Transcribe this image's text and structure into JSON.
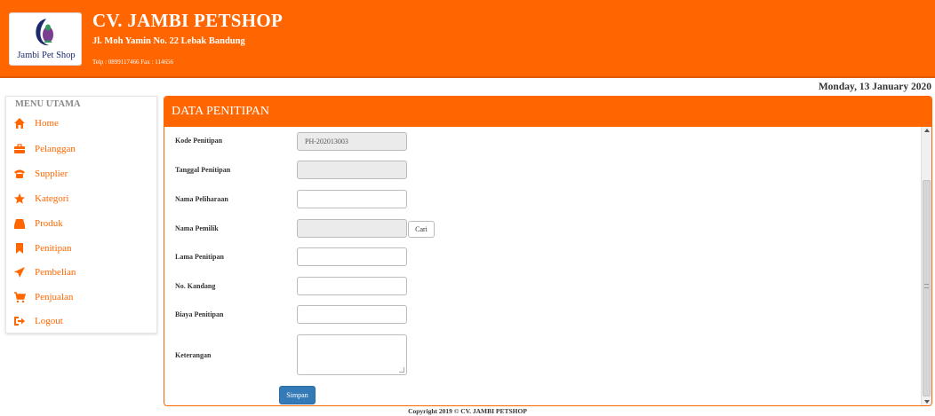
{
  "header": {
    "company_name": "CV. JAMBI PETSHOP",
    "address": "Jl. Moh Yamin No. 22 Lebak Bandung",
    "phone": "Telp : 0899117466 Fax : 114656",
    "logo_text": "Jambi Pet Shop",
    "color": "#ff6600"
  },
  "date": "Monday, 13 January 2020",
  "sidebar": {
    "title": "MENU UTAMA",
    "items": [
      {
        "label": "Home",
        "icon": "home-icon"
      },
      {
        "label": "Pelanggan",
        "icon": "briefcase-icon"
      },
      {
        "label": "Supplier",
        "icon": "phone-icon"
      },
      {
        "label": "Kategori",
        "icon": "star-icon"
      },
      {
        "label": "Produk",
        "icon": "hdd-icon"
      },
      {
        "label": "Penitipan",
        "icon": "bookmark-icon"
      },
      {
        "label": "Pembelian",
        "icon": "send-icon"
      },
      {
        "label": "Penjualan",
        "icon": "cart-icon"
      },
      {
        "label": "Logout",
        "icon": "logout-icon"
      }
    ]
  },
  "panel": {
    "title": "DATA PENITIPAN",
    "fields": {
      "kode": {
        "label": "Kode Penitipan",
        "value": "PH-202013003"
      },
      "tanggal": {
        "label": "Tanggal Penitipan",
        "value": ""
      },
      "nama_peliharaan": {
        "label": "Nama Peliharaan",
        "value": ""
      },
      "nama_pemilik": {
        "label": "Nama Pemilik",
        "value": ""
      },
      "lama": {
        "label": "Lama Penitipan",
        "value": ""
      },
      "kandang": {
        "label": "No. Kandang",
        "value": ""
      },
      "biaya": {
        "label": "Biaya Penitipan",
        "value": ""
      },
      "keterangan": {
        "label": "Keterangan",
        "value": ""
      }
    },
    "cari_label": "Cari",
    "simpan_label": "Simpan"
  },
  "footer": "Copyright 2019 © CV. JAMBI PETSHOP"
}
